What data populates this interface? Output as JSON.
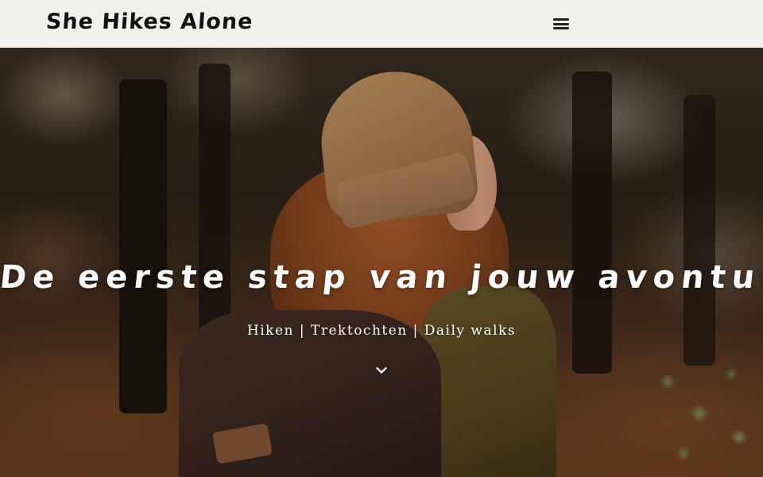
{
  "header": {
    "logo_text": "She Hikes Alone",
    "menu_icon": "hamburger-menu-icon",
    "background_color": "#f3f1ee"
  },
  "hero": {
    "title": "De eerste stap van jouw avontuur",
    "subtitle": "Hiken | Trektochten | Daily walks",
    "scroll_icon": "chevron-down-icon",
    "text_color": "#ffffff"
  }
}
